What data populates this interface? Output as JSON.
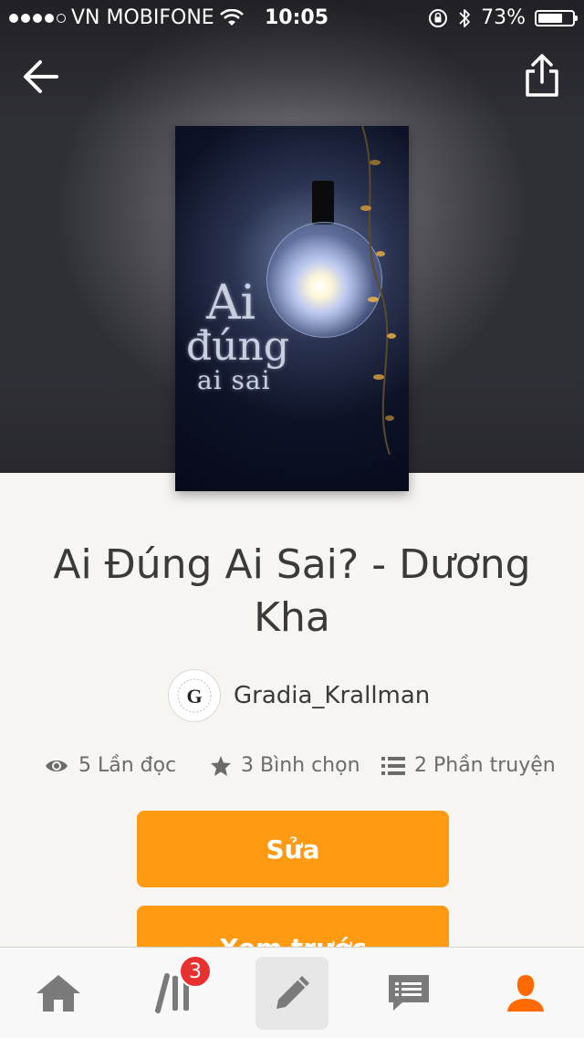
{
  "status_bar": {
    "carrier": "VN MOBIFONE",
    "time": "10:05",
    "battery_percent": "73%",
    "battery_level": 0.73,
    "signal_dots_filled": 4
  },
  "header": {
    "back_icon": "arrow-left-icon",
    "share_icon": "share-icon"
  },
  "cover": {
    "line1": "Ai",
    "line2": "đúng",
    "line3": "ai sai"
  },
  "story": {
    "title": "Ai Đúng Ai Sai? - Dương Kha",
    "author": "Gradia_Krallman",
    "avatar_letter": "G"
  },
  "stats": {
    "reads": "5 Lần đọc",
    "votes": "3 Bình chọn",
    "parts": "2 Phần truyện"
  },
  "actions": {
    "edit_label": "Sửa",
    "preview_label": "Xem trước"
  },
  "tabbar": {
    "items": [
      {
        "name": "home",
        "icon": "home-icon"
      },
      {
        "name": "library",
        "icon": "library-icon",
        "badge": "3"
      },
      {
        "name": "write",
        "icon": "pencil-icon",
        "active": true
      },
      {
        "name": "messages",
        "icon": "messages-icon"
      },
      {
        "name": "profile",
        "icon": "profile-icon",
        "active_color": "#ff6a00"
      }
    ]
  },
  "colors": {
    "accent": "#ff9a12",
    "badge": "#e8302e",
    "profile_active": "#ff6a00"
  }
}
